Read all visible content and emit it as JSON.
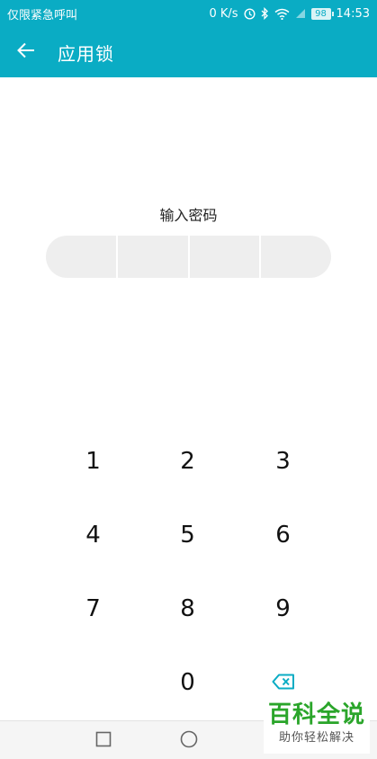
{
  "status_bar": {
    "left_text": "仅限紧急呼叫",
    "speed": "0 K/s",
    "battery": "98",
    "time": "14:53"
  },
  "app_bar": {
    "title": "应用锁",
    "back_icon": "arrow-left-icon"
  },
  "prompt": "输入密码",
  "pin": {
    "length": 4
  },
  "keypad": {
    "keys": [
      "1",
      "2",
      "3",
      "4",
      "5",
      "6",
      "7",
      "8",
      "9",
      "",
      "0",
      "delete"
    ]
  },
  "nav_bar": {
    "icons": [
      "recents-square-icon",
      "home-circle-icon"
    ]
  },
  "watermark": {
    "title": "百科全说",
    "subtitle": "助你轻松解决"
  },
  "colors": {
    "accent": "#0aacc4",
    "pin_bg": "#eeeeee",
    "watermark_green": "#2aa52a"
  }
}
